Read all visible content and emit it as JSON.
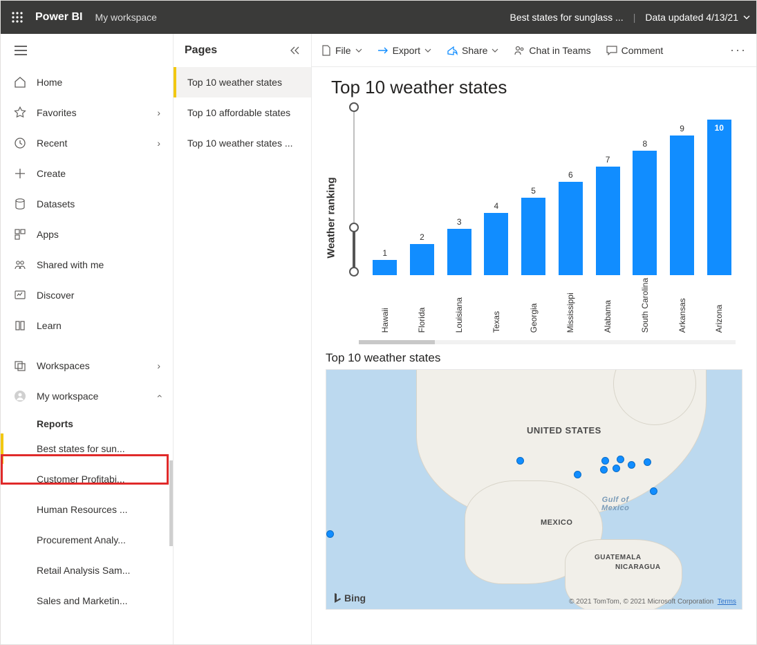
{
  "topbar": {
    "brand": "Power BI",
    "workspace": "My workspace",
    "report_title": "Best states for sunglass ...",
    "updated_label": "Data updated 4/13/21"
  },
  "nav": {
    "items": [
      {
        "id": "home",
        "label": "Home"
      },
      {
        "id": "favorites",
        "label": "Favorites",
        "more": true
      },
      {
        "id": "recent",
        "label": "Recent",
        "more": true
      },
      {
        "id": "create",
        "label": "Create"
      },
      {
        "id": "datasets",
        "label": "Datasets"
      },
      {
        "id": "apps",
        "label": "Apps"
      },
      {
        "id": "shared",
        "label": "Shared with me"
      },
      {
        "id": "discover",
        "label": "Discover"
      },
      {
        "id": "learn",
        "label": "Learn"
      }
    ],
    "workspaces_label": "Workspaces",
    "myworkspace_label": "My workspace",
    "reports_header": "Reports",
    "reports": [
      "Best states for sun...",
      "Customer Profitabi...",
      "Human Resources ...",
      "Procurement Analy...",
      "Retail Analysis Sam...",
      "Sales and Marketin..."
    ]
  },
  "pages": {
    "header": "Pages",
    "items": [
      "Top 10 weather states",
      "Top 10 affordable states",
      "Top 10 weather states ..."
    ],
    "selected": 0
  },
  "commandbar": {
    "file": "File",
    "export": "Export",
    "share": "Share",
    "chat": "Chat in Teams",
    "comment": "Comment"
  },
  "visual": {
    "title": "Top 10 weather states",
    "ylabel": "Weather ranking"
  },
  "chart_data": {
    "type": "bar",
    "title": "Top 10 weather states",
    "ylabel": "Weather ranking",
    "categories": [
      "Hawaii",
      "Florida",
      "Louisiana",
      "Texas",
      "Georgia",
      "Mississippi",
      "Alabama",
      "South Carolina",
      "Arkansas",
      "Arizona"
    ],
    "values": [
      1,
      2,
      3,
      4,
      5,
      6,
      7,
      8,
      9,
      10
    ],
    "ylim": [
      0,
      10
    ]
  },
  "map": {
    "title": "Top 10 weather states",
    "labels": {
      "us": "UNITED STATES",
      "mexico": "MEXICO",
      "gulf": "Gulf of\nMexico",
      "guatemala": "GUATEMALA",
      "nicaragua": "NICARAGUA"
    },
    "bing": "Bing",
    "attrib": "© 2021 TomTom, © 2021 Microsoft Corporation",
    "terms": "Terms"
  }
}
